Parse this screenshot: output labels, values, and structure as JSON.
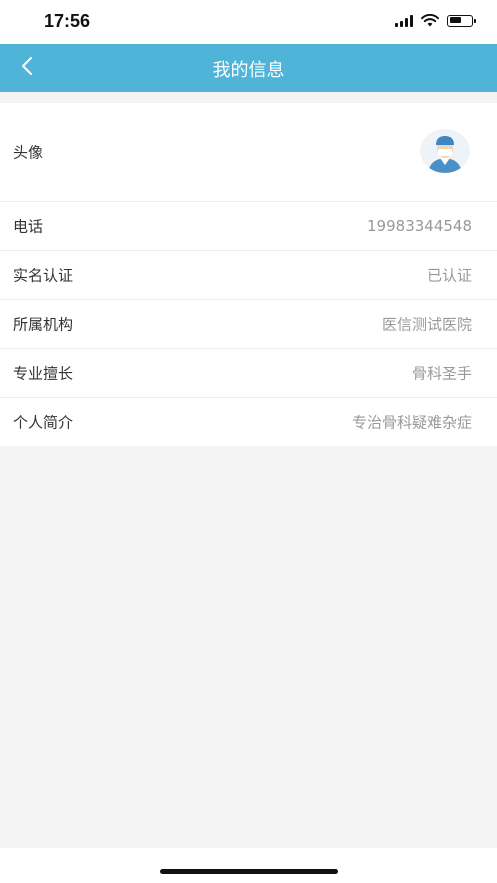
{
  "status": {
    "time": "17:56",
    "battery_level": 0.55
  },
  "nav": {
    "title": "我的信息",
    "back_icon": "chevron-left-icon"
  },
  "colors": {
    "nav_bg": "#4fb4d8",
    "label": "#333333",
    "value": "#999999",
    "page_bg": "#f3f3f3"
  },
  "rows": {
    "avatar": {
      "label": "头像",
      "icon": "doctor-avatar-icon"
    },
    "phone": {
      "label": "电话",
      "value": "19983344548"
    },
    "verification": {
      "label": "实名认证",
      "value": "已认证"
    },
    "institution": {
      "label": "所属机构",
      "value": "医信测试医院"
    },
    "specialty": {
      "label": "专业擅长",
      "value": "骨科圣手"
    },
    "bio": {
      "label": "个人简介",
      "value": "专治骨科疑难杂症"
    }
  }
}
